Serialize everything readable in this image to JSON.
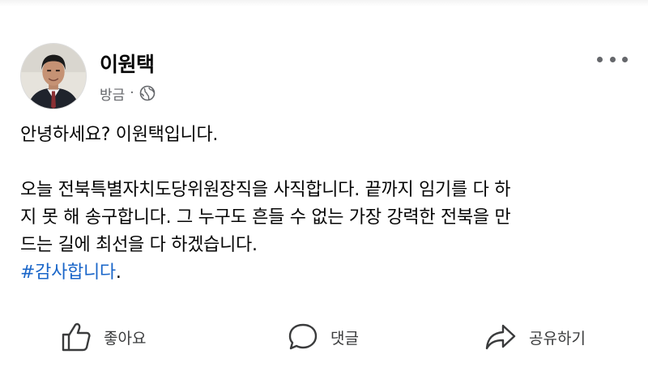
{
  "post": {
    "author": "이원택",
    "time": "방금",
    "separator": "·",
    "privacy_icon": "globe-icon",
    "more_icon": "more-dots-icon",
    "lines": [
      "안녕하세요? 이원택입니다.",
      "오늘 전북특별자치도당위원장직을 사직합니다. 끝까지 임기를 다 하",
      "지 못 해 송구합니다. 그 누구도 흔들 수 없는 가장 강력한 전북을 만",
      "드는 길에 최선을 다 하겠습니다."
    ],
    "hashtag": "#감사합니다",
    "hashtag_suffix": ".",
    "hashtag_color": "#1a66c9"
  },
  "actions": {
    "like_label": "좋아요",
    "like_icon": "thumbs-up-icon",
    "comment_label": "댓글",
    "comment_icon": "comment-bubble-icon",
    "share_label": "공유하기",
    "share_icon": "share-arrow-icon"
  }
}
